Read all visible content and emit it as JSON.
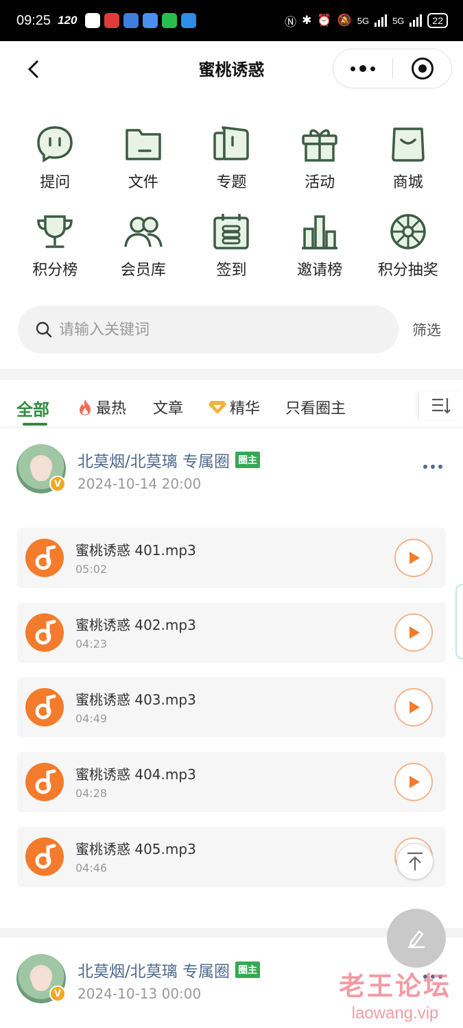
{
  "status_bar": {
    "time": "09:25",
    "refresh_rate": "120",
    "battery": "22",
    "network_1": "5G",
    "network_2": "5G"
  },
  "nav": {
    "title": "蜜桃诱惑"
  },
  "menu": [
    {
      "label": "提问",
      "icon": "question-bubble-icon"
    },
    {
      "label": "文件",
      "icon": "folder-icon"
    },
    {
      "label": "专题",
      "icon": "topic-book-icon"
    },
    {
      "label": "活动",
      "icon": "gift-icon"
    },
    {
      "label": "商城",
      "icon": "shopping-bag-icon"
    },
    {
      "label": "积分榜",
      "icon": "trophy-icon"
    },
    {
      "label": "会员库",
      "icon": "members-icon"
    },
    {
      "label": "签到",
      "icon": "calendar-checkin-icon"
    },
    {
      "label": "邀请榜",
      "icon": "bar-chart-icon"
    },
    {
      "label": "积分抽奖",
      "icon": "lottery-wheel-icon"
    }
  ],
  "search": {
    "placeholder": "请输入关键词",
    "filter_label": "筛选"
  },
  "tabs": [
    {
      "label": "全部",
      "active": true
    },
    {
      "label": "最热",
      "icon": "flame-icon"
    },
    {
      "label": "文章"
    },
    {
      "label": "精华",
      "icon": "diamond-icon"
    },
    {
      "label": "只看圈主"
    }
  ],
  "posts": [
    {
      "author": "北莫烟/北莫璃 专属圈",
      "tag": "圈主",
      "date": "2024-10-14 20:00",
      "badge": "V",
      "audios": [
        {
          "name": "蜜桃诱惑 401.mp3",
          "duration": "05:02"
        },
        {
          "name": "蜜桃诱惑 402.mp3",
          "duration": "04:23"
        },
        {
          "name": "蜜桃诱惑 403.mp3",
          "duration": "04:49"
        },
        {
          "name": "蜜桃诱惑 404.mp3",
          "duration": "04:28"
        },
        {
          "name": "蜜桃诱惑 405.mp3",
          "duration": "04:46"
        }
      ]
    },
    {
      "author": "北莫烟/北莫璃 专属圈",
      "tag": "圈主",
      "date": "2024-10-13 00:00",
      "badge": "V"
    }
  ],
  "watermark": {
    "cn": "老王论坛",
    "en": "laowang.vip"
  },
  "colors": {
    "accent_green": "#2f8a3e",
    "icon_green": "#3d5c45",
    "audio_orange": "#f47b2c",
    "author_blue": "#4f6a8e"
  }
}
